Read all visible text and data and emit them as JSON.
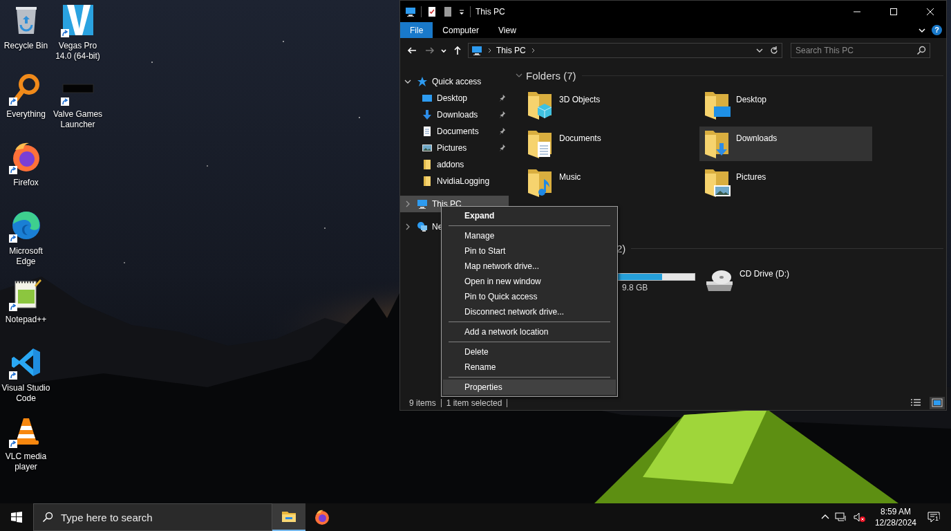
{
  "desktop_icons": [
    {
      "kind": "recycle_bin",
      "label": "Recycle Bin",
      "shortcut": false
    },
    {
      "kind": "everything",
      "label": "Everything",
      "shortcut": true
    },
    {
      "kind": "firefox",
      "label": "Firefox",
      "shortcut": true
    },
    {
      "kind": "edge",
      "label": "Microsoft Edge",
      "shortcut": true
    },
    {
      "kind": "notepad",
      "label": "Notepad++",
      "shortcut": true
    },
    {
      "kind": "vscode",
      "label": "Visual Studio Code",
      "shortcut": true
    },
    {
      "kind": "vlc",
      "label": "VLC media player",
      "shortcut": true
    },
    {
      "kind": "vegas",
      "label": "Vegas Pro 14.0 (64-bit)",
      "shortcut": true
    },
    {
      "kind": "valve",
      "label": "Valve Games Launcher",
      "shortcut": true
    }
  ],
  "explorer": {
    "title": "This PC",
    "ribbon_tabs": [
      {
        "label": "File",
        "selected": true
      },
      {
        "label": "Computer",
        "selected": false
      },
      {
        "label": "View",
        "selected": false
      }
    ],
    "help": "?",
    "nav_buttons": [
      {
        "kind": "back",
        "disabled": false
      },
      {
        "kind": "forward",
        "disabled": true
      },
      {
        "kind": "recent",
        "disabled": false
      },
      {
        "kind": "up",
        "disabled": false
      }
    ],
    "address": {
      "segments": [
        "This PC"
      ]
    },
    "search": {
      "placeholder": "Search This PC"
    },
    "nav_pane": [
      {
        "kind": "quick_access",
        "label": "Quick access",
        "expanded": true,
        "selected": false,
        "children": [
          {
            "kind": "desktop",
            "label": "Desktop",
            "pinned": true,
            "selected": false
          },
          {
            "kind": "downloads",
            "label": "Downloads",
            "pinned": true,
            "selected": false
          },
          {
            "kind": "documents",
            "label": "Documents",
            "pinned": true,
            "selected": false
          },
          {
            "kind": "pictures",
            "label": "Pictures",
            "pinned": true,
            "selected": false
          },
          {
            "kind": "folder",
            "label": "addons",
            "pinned": false,
            "selected": false
          },
          {
            "kind": "folder",
            "label": "NvidiaLogging",
            "pinned": false,
            "selected": false
          }
        ]
      },
      {
        "kind": "pc",
        "label": "This PC",
        "expanded": false,
        "selected": true
      },
      {
        "kind": "network",
        "label": "Ne",
        "expanded": false,
        "selected": false
      }
    ],
    "folders": {
      "title": "Folders (7)",
      "expanded": true,
      "items": [
        {
          "kind": "objects",
          "label": "3D Objects",
          "selected": false
        },
        {
          "kind": "desktop",
          "label": "Desktop",
          "selected": false
        },
        {
          "kind": "documents",
          "label": "Documents",
          "selected": false
        },
        {
          "kind": "downloads",
          "label": "Downloads",
          "selected": true
        },
        {
          "kind": "music",
          "label": "Music",
          "selected": false
        },
        {
          "kind": "pictures",
          "label": "Pictures",
          "selected": false
        }
      ]
    },
    "drives": {
      "title": "2)",
      "items": [
        {
          "kind": "disk",
          "free": "9.8 GB",
          "level": 0.78
        },
        {
          "kind": "cd",
          "label": "CD Drive (D:)"
        }
      ]
    },
    "status_bar": {
      "count": "9 items",
      "selection": "1 item selected",
      "views": [
        {
          "kind": "details",
          "selected": false
        },
        {
          "kind": "tiles",
          "selected": true
        }
      ]
    }
  },
  "context_menu": {
    "sections": [
      [
        {
          "label": "Expand",
          "default": true,
          "selected": false
        }
      ],
      [
        {
          "label": "Manage",
          "default": false,
          "selected": false
        },
        {
          "label": "Pin to Start",
          "default": false,
          "selected": false
        },
        {
          "label": "Map network drive...",
          "default": false,
          "selected": false
        },
        {
          "label": "Open in new window",
          "default": false,
          "selected": false
        },
        {
          "label": "Pin to Quick access",
          "default": false,
          "selected": false
        },
        {
          "label": "Disconnect network drive...",
          "default": false,
          "selected": false
        }
      ],
      [
        {
          "label": "Add a network location",
          "default": false,
          "selected": false
        }
      ],
      [
        {
          "label": "Delete",
          "default": false,
          "selected": false
        },
        {
          "label": "Rename",
          "default": false,
          "selected": false
        }
      ],
      [
        {
          "label": "Properties",
          "default": false,
          "selected": true
        }
      ]
    ]
  },
  "taskbar": {
    "search": {
      "placeholder": "Type here to search"
    },
    "apps": [
      {
        "kind": "file_explorer",
        "active": true
      },
      {
        "kind": "firefox",
        "active": false
      }
    ],
    "tray": {
      "volume_muted": true,
      "time": "8:59 AM",
      "date": "12/28/2024",
      "notification_count": "1"
    }
  }
}
